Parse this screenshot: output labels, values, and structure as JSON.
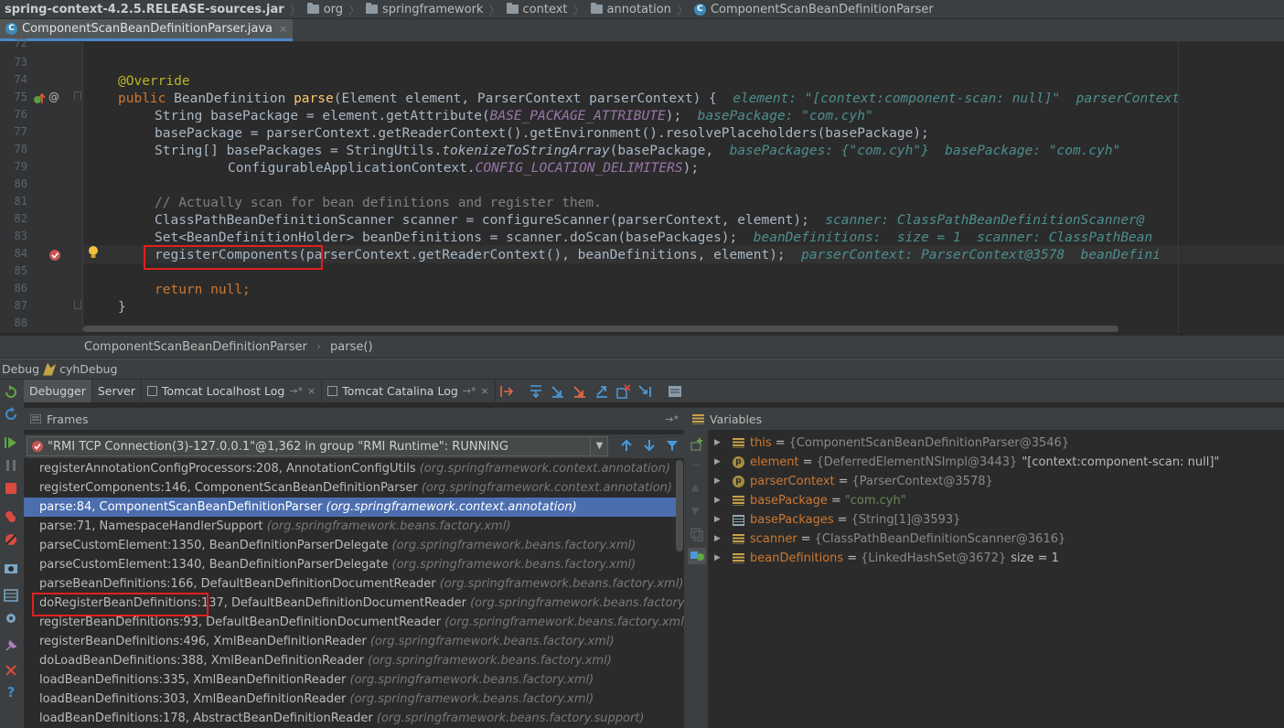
{
  "breadcrumb": [
    "spring-context-4.2.5.RELEASE-sources.jar",
    "org",
    "springframework",
    "context",
    "annotation",
    "ComponentScanBeanDefinitionParser"
  ],
  "editor_tab": {
    "label": "ComponentScanBeanDefinitionParser.java",
    "close": "×"
  },
  "line_numbers": [
    "72",
    "73",
    "74",
    "75",
    "76",
    "77",
    "78",
    "79",
    "80",
    "81",
    "82",
    "83",
    "84",
    "85",
    "86",
    "87",
    "88"
  ],
  "code": {
    "l74_annotation": "@Override",
    "l75_kw": "public",
    "l75_type": "BeanDefinition",
    "l75_method": "parse",
    "l75_params": "(Element element, ParserContext parserContext) {",
    "l75_hint": "element: \"[context:component-scan: null]\"  parserContext",
    "l76_a": "String basePackage = element.getAttribute(",
    "l76_const": "BASE_PACKAGE_ATTRIBUTE",
    "l76_b": ");",
    "l76_hint": "basePackage: \"com.cyh\"",
    "l77": "basePackage = parserContext.getReaderContext().getEnvironment().resolvePlaceholders(basePackage);",
    "l78_a": "String[] basePackages = StringUtils.",
    "l78_static": "tokenizeToStringArray",
    "l78_b": "(basePackage,",
    "l78_hint": "basePackages: {\"com.cyh\"}  basePackage: \"com.cyh\"",
    "l79_a": "ConfigurableApplicationContext.",
    "l79_const": "CONFIG_LOCATION_DELIMITERS",
    "l79_b": ");",
    "l81_comment": "// Actually scan for bean definitions and register them.",
    "l82": "ClassPathBeanDefinitionScanner scanner = configureScanner(parserContext, element);",
    "l82_hint": "scanner: ClassPathBeanDefinitionScanner@",
    "l83": "Set<BeanDefinitionHolder> beanDefinitions = scanner.doScan(basePackages);",
    "l83_hint": "beanDefinitions:  size = 1  scanner: ClassPathBean",
    "l84_call": "registerComponents",
    "l84_rest": "(parserContext.getReaderContext(), beanDefinitions, element);",
    "l84_hint": "parserContext: ParserContext@3578  beanDefini",
    "l86_kw": "return",
    "l86_null": "null",
    "l86_end": ";",
    "l87": "}"
  },
  "editor_breadcrumb": [
    "ComponentScanBeanDefinitionParser",
    "parse()"
  ],
  "debug_title": {
    "label": "Debug",
    "config": "cyhDebug"
  },
  "debug_tabs": [
    {
      "label": "Debugger",
      "active": true
    },
    {
      "label": "Server"
    },
    {
      "label": "Tomcat Localhost Log",
      "pin": "→*",
      "close": "×"
    },
    {
      "label": "Tomcat Catalina Log",
      "pin": "→*",
      "close": "×"
    }
  ],
  "frames": {
    "header": "Frames",
    "pin": "→*",
    "thread": "\"RMI TCP Connection(3)-127.0.0.1\"@1,362 in group \"RMI Runtime\": RUNNING",
    "items": [
      {
        "method": "registerAnnotationConfigProcessors:208, AnnotationConfigUtils",
        "pkg": "(org.springframework.context.annotation)"
      },
      {
        "method": "registerComponents:146, ComponentScanBeanDefinitionParser",
        "pkg": "(org.springframework.context.annotation)"
      },
      {
        "method": "parse:84, ComponentScanBeanDefinitionParser",
        "pkg": "(org.springframework.context.annotation)",
        "selected": true
      },
      {
        "method": "parse:71, NamespaceHandlerSupport",
        "pkg": "(org.springframework.beans.factory.xml)"
      },
      {
        "method": "parseCustomElement:1350, BeanDefinitionParserDelegate",
        "pkg": "(org.springframework.beans.factory.xml)"
      },
      {
        "method": "parseCustomElement:1340, BeanDefinitionParserDelegate",
        "pkg": "(org.springframework.beans.factory.xml)"
      },
      {
        "method": "parseBeanDefinitions:166, DefaultBeanDefinitionDocumentReader",
        "pkg": "(org.springframework.beans.factory.xml)"
      },
      {
        "method": "doRegisterBeanDefinitions:137, DefaultBeanDefinitionDocumentReader",
        "pkg": "(org.springframework.beans.factory.xml)"
      },
      {
        "method": "registerBeanDefinitions:93, DefaultBeanDefinitionDocumentReader",
        "pkg": "(org.springframework.beans.factory.xml)"
      },
      {
        "method": "registerBeanDefinitions:496, XmlBeanDefinitionReader",
        "pkg": "(org.springframework.beans.factory.xml)"
      },
      {
        "method": "doLoadBeanDefinitions:388, XmlBeanDefinitionReader",
        "pkg": "(org.springframework.beans.factory.xml)"
      },
      {
        "method": "loadBeanDefinitions:335, XmlBeanDefinitionReader",
        "pkg": "(org.springframework.beans.factory.xml)"
      },
      {
        "method": "loadBeanDefinitions:303, XmlBeanDefinitionReader",
        "pkg": "(org.springframework.beans.factory.xml)"
      },
      {
        "method": "loadBeanDefinitions:178, AbstractBeanDefinitionReader",
        "pkg": "(org.springframework.beans.factory.support)"
      }
    ]
  },
  "variables": {
    "header": "Variables",
    "items": [
      {
        "name": "this",
        "icon": "field",
        "value": "{ComponentScanBeanDefinitionParser@3546}",
        "kind": "obj"
      },
      {
        "name": "element",
        "icon": "param",
        "value": "{DeferredElementNSImpl@3443}",
        "kind": "obj",
        "extra": "\"[context:component-scan: null]\""
      },
      {
        "name": "parserContext",
        "icon": "param",
        "value": "{ParserContext@3578}",
        "kind": "obj"
      },
      {
        "name": "basePackage",
        "icon": "field",
        "value": "\"com.cyh\"",
        "kind": "str"
      },
      {
        "name": "basePackages",
        "icon": "array",
        "value": "{String[1]@3593}",
        "kind": "obj"
      },
      {
        "name": "scanner",
        "icon": "field",
        "value": "{ClassPathBeanDefinitionScanner@3616}",
        "kind": "obj"
      },
      {
        "name": "beanDefinitions",
        "icon": "field",
        "value": "{LinkedHashSet@3672}",
        "kind": "obj",
        "extra": "size = 1"
      }
    ]
  },
  "colors": {
    "accent": "#4a88c7",
    "selection": "#4b6eaf",
    "highlight_box": "#e02020",
    "keyword": "#cc7832",
    "hint": "#4e8e8e"
  }
}
